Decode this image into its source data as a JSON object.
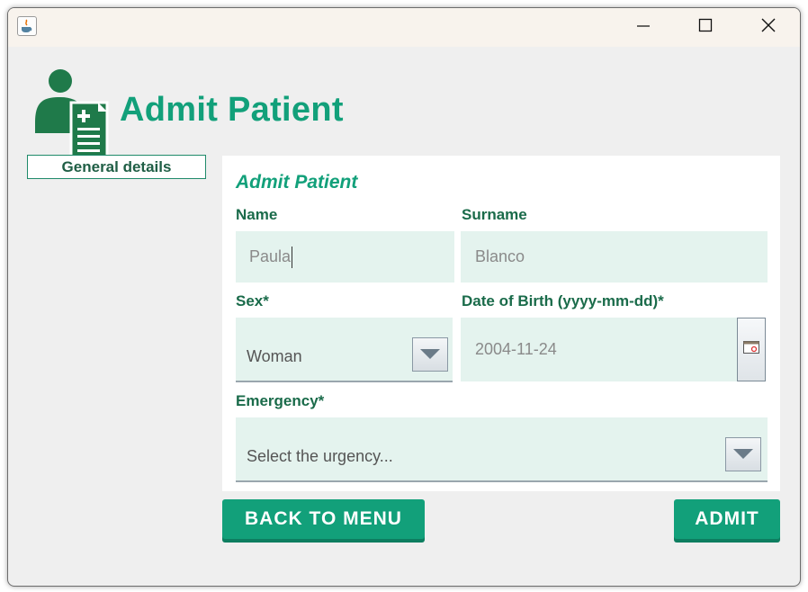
{
  "window": {
    "title": "",
    "controls": {
      "minimize": "minimize-icon",
      "maximize": "maximize-icon",
      "close": "close-icon"
    }
  },
  "header": {
    "title": "Admit Patient",
    "icon": "patient-clipboard-icon"
  },
  "sidebar": {
    "tabs": [
      {
        "label": "General details"
      }
    ]
  },
  "form": {
    "heading": "Admit Patient",
    "name": {
      "label": "Name",
      "value": "Paula"
    },
    "surname": {
      "label": "Surname",
      "value": "Blanco"
    },
    "sex": {
      "label": "Sex*",
      "value": "Woman"
    },
    "dob": {
      "label": "Date of Birth (yyyy-mm-dd)*",
      "value": "2004-11-24"
    },
    "emergency": {
      "label": "Emergency*",
      "value": "Select the urgency..."
    }
  },
  "actions": {
    "back_label": "BACK TO MENU",
    "admit_label": "ADMIT"
  },
  "colors": {
    "accent": "#12a07a",
    "accent_dark": "#1a6b4a",
    "field_bg": "#e4f3ee",
    "window_bg": "#efefef"
  }
}
